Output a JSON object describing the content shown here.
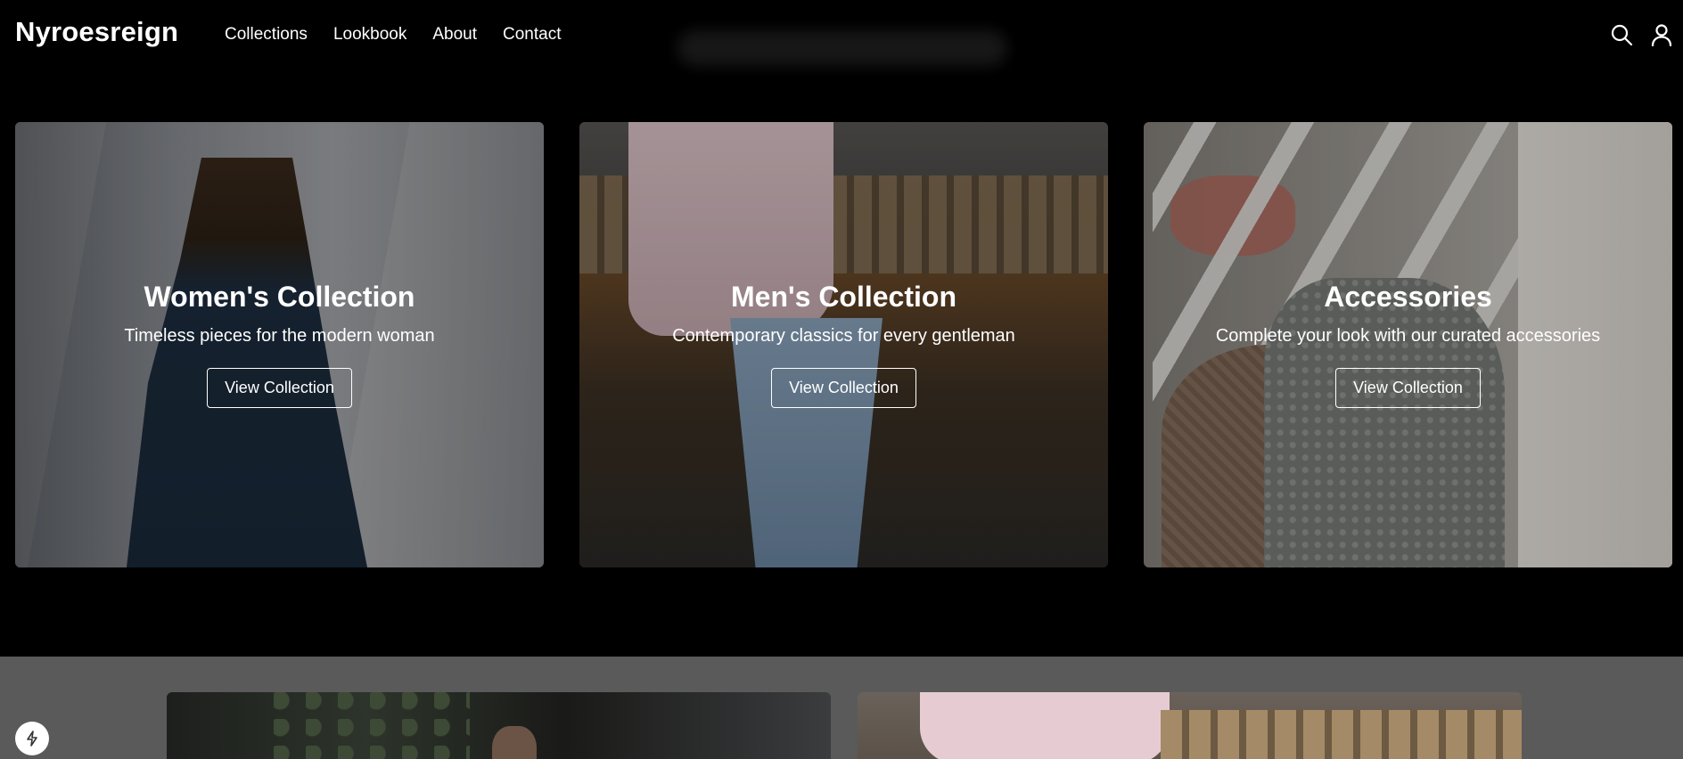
{
  "header": {
    "brand": "Nyroesreign",
    "nav": [
      "Collections",
      "Lookbook",
      "About",
      "Contact"
    ]
  },
  "cards": [
    {
      "title": "Women's Collection",
      "subtitle": "Timeless pieces for the modern woman",
      "button": "View Collection"
    },
    {
      "title": "Men's Collection",
      "subtitle": "Contemporary classics for every gentleman",
      "button": "View Collection"
    },
    {
      "title": "Accessories",
      "subtitle": "Complete your look with our curated accessories",
      "button": "View Collection"
    }
  ],
  "icons": {
    "search": "search-icon",
    "user": "user-icon",
    "badge": "lightning-icon"
  }
}
